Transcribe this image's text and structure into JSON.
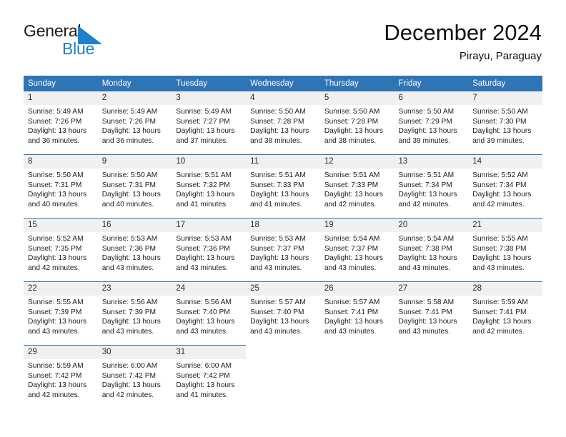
{
  "brand": {
    "name_part1": "General",
    "name_part2": "Blue",
    "logo_icon": "triangle-logo-icon",
    "color_primary": "#1f7fd0",
    "color_dark": "#1a1a1a"
  },
  "header": {
    "title": "December 2024",
    "subtitle": "Pirayu, Paraguay"
  },
  "theme": {
    "header_row_bg": "#2f74b5",
    "day_number_bg": "#f0f0f0",
    "cell_border": "#2f74b5",
    "text": "#1c1c1c"
  },
  "weekdays": [
    "Sunday",
    "Monday",
    "Tuesday",
    "Wednesday",
    "Thursday",
    "Friday",
    "Saturday"
  ],
  "weeks": [
    [
      {
        "day": "1",
        "sunrise": "Sunrise: 5:49 AM",
        "sunset": "Sunset: 7:26 PM",
        "daylight_l1": "Daylight: 13 hours",
        "daylight_l2": "and 36 minutes."
      },
      {
        "day": "2",
        "sunrise": "Sunrise: 5:49 AM",
        "sunset": "Sunset: 7:26 PM",
        "daylight_l1": "Daylight: 13 hours",
        "daylight_l2": "and 36 minutes."
      },
      {
        "day": "3",
        "sunrise": "Sunrise: 5:49 AM",
        "sunset": "Sunset: 7:27 PM",
        "daylight_l1": "Daylight: 13 hours",
        "daylight_l2": "and 37 minutes."
      },
      {
        "day": "4",
        "sunrise": "Sunrise: 5:50 AM",
        "sunset": "Sunset: 7:28 PM",
        "daylight_l1": "Daylight: 13 hours",
        "daylight_l2": "and 38 minutes."
      },
      {
        "day": "5",
        "sunrise": "Sunrise: 5:50 AM",
        "sunset": "Sunset: 7:28 PM",
        "daylight_l1": "Daylight: 13 hours",
        "daylight_l2": "and 38 minutes."
      },
      {
        "day": "6",
        "sunrise": "Sunrise: 5:50 AM",
        "sunset": "Sunset: 7:29 PM",
        "daylight_l1": "Daylight: 13 hours",
        "daylight_l2": "and 39 minutes."
      },
      {
        "day": "7",
        "sunrise": "Sunrise: 5:50 AM",
        "sunset": "Sunset: 7:30 PM",
        "daylight_l1": "Daylight: 13 hours",
        "daylight_l2": "and 39 minutes."
      }
    ],
    [
      {
        "day": "8",
        "sunrise": "Sunrise: 5:50 AM",
        "sunset": "Sunset: 7:31 PM",
        "daylight_l1": "Daylight: 13 hours",
        "daylight_l2": "and 40 minutes."
      },
      {
        "day": "9",
        "sunrise": "Sunrise: 5:50 AM",
        "sunset": "Sunset: 7:31 PM",
        "daylight_l1": "Daylight: 13 hours",
        "daylight_l2": "and 40 minutes."
      },
      {
        "day": "10",
        "sunrise": "Sunrise: 5:51 AM",
        "sunset": "Sunset: 7:32 PM",
        "daylight_l1": "Daylight: 13 hours",
        "daylight_l2": "and 41 minutes."
      },
      {
        "day": "11",
        "sunrise": "Sunrise: 5:51 AM",
        "sunset": "Sunset: 7:33 PM",
        "daylight_l1": "Daylight: 13 hours",
        "daylight_l2": "and 41 minutes."
      },
      {
        "day": "12",
        "sunrise": "Sunrise: 5:51 AM",
        "sunset": "Sunset: 7:33 PM",
        "daylight_l1": "Daylight: 13 hours",
        "daylight_l2": "and 42 minutes."
      },
      {
        "day": "13",
        "sunrise": "Sunrise: 5:51 AM",
        "sunset": "Sunset: 7:34 PM",
        "daylight_l1": "Daylight: 13 hours",
        "daylight_l2": "and 42 minutes."
      },
      {
        "day": "14",
        "sunrise": "Sunrise: 5:52 AM",
        "sunset": "Sunset: 7:34 PM",
        "daylight_l1": "Daylight: 13 hours",
        "daylight_l2": "and 42 minutes."
      }
    ],
    [
      {
        "day": "15",
        "sunrise": "Sunrise: 5:52 AM",
        "sunset": "Sunset: 7:35 PM",
        "daylight_l1": "Daylight: 13 hours",
        "daylight_l2": "and 42 minutes."
      },
      {
        "day": "16",
        "sunrise": "Sunrise: 5:53 AM",
        "sunset": "Sunset: 7:36 PM",
        "daylight_l1": "Daylight: 13 hours",
        "daylight_l2": "and 43 minutes."
      },
      {
        "day": "17",
        "sunrise": "Sunrise: 5:53 AM",
        "sunset": "Sunset: 7:36 PM",
        "daylight_l1": "Daylight: 13 hours",
        "daylight_l2": "and 43 minutes."
      },
      {
        "day": "18",
        "sunrise": "Sunrise: 5:53 AM",
        "sunset": "Sunset: 7:37 PM",
        "daylight_l1": "Daylight: 13 hours",
        "daylight_l2": "and 43 minutes."
      },
      {
        "day": "19",
        "sunrise": "Sunrise: 5:54 AM",
        "sunset": "Sunset: 7:37 PM",
        "daylight_l1": "Daylight: 13 hours",
        "daylight_l2": "and 43 minutes."
      },
      {
        "day": "20",
        "sunrise": "Sunrise: 5:54 AM",
        "sunset": "Sunset: 7:38 PM",
        "daylight_l1": "Daylight: 13 hours",
        "daylight_l2": "and 43 minutes."
      },
      {
        "day": "21",
        "sunrise": "Sunrise: 5:55 AM",
        "sunset": "Sunset: 7:38 PM",
        "daylight_l1": "Daylight: 13 hours",
        "daylight_l2": "and 43 minutes."
      }
    ],
    [
      {
        "day": "22",
        "sunrise": "Sunrise: 5:55 AM",
        "sunset": "Sunset: 7:39 PM",
        "daylight_l1": "Daylight: 13 hours",
        "daylight_l2": "and 43 minutes."
      },
      {
        "day": "23",
        "sunrise": "Sunrise: 5:56 AM",
        "sunset": "Sunset: 7:39 PM",
        "daylight_l1": "Daylight: 13 hours",
        "daylight_l2": "and 43 minutes."
      },
      {
        "day": "24",
        "sunrise": "Sunrise: 5:56 AM",
        "sunset": "Sunset: 7:40 PM",
        "daylight_l1": "Daylight: 13 hours",
        "daylight_l2": "and 43 minutes."
      },
      {
        "day": "25",
        "sunrise": "Sunrise: 5:57 AM",
        "sunset": "Sunset: 7:40 PM",
        "daylight_l1": "Daylight: 13 hours",
        "daylight_l2": "and 43 minutes."
      },
      {
        "day": "26",
        "sunrise": "Sunrise: 5:57 AM",
        "sunset": "Sunset: 7:41 PM",
        "daylight_l1": "Daylight: 13 hours",
        "daylight_l2": "and 43 minutes."
      },
      {
        "day": "27",
        "sunrise": "Sunrise: 5:58 AM",
        "sunset": "Sunset: 7:41 PM",
        "daylight_l1": "Daylight: 13 hours",
        "daylight_l2": "and 43 minutes."
      },
      {
        "day": "28",
        "sunrise": "Sunrise: 5:59 AM",
        "sunset": "Sunset: 7:41 PM",
        "daylight_l1": "Daylight: 13 hours",
        "daylight_l2": "and 42 minutes."
      }
    ],
    [
      {
        "day": "29",
        "sunrise": "Sunrise: 5:59 AM",
        "sunset": "Sunset: 7:42 PM",
        "daylight_l1": "Daylight: 13 hours",
        "daylight_l2": "and 42 minutes."
      },
      {
        "day": "30",
        "sunrise": "Sunrise: 6:00 AM",
        "sunset": "Sunset: 7:42 PM",
        "daylight_l1": "Daylight: 13 hours",
        "daylight_l2": "and 42 minutes."
      },
      {
        "day": "31",
        "sunrise": "Sunrise: 6:00 AM",
        "sunset": "Sunset: 7:42 PM",
        "daylight_l1": "Daylight: 13 hours",
        "daylight_l2": "and 41 minutes."
      },
      {
        "day": "",
        "sunrise": "",
        "sunset": "",
        "daylight_l1": "",
        "daylight_l2": "",
        "blank": true
      },
      {
        "day": "",
        "sunrise": "",
        "sunset": "",
        "daylight_l1": "",
        "daylight_l2": "",
        "blank": true
      },
      {
        "day": "",
        "sunrise": "",
        "sunset": "",
        "daylight_l1": "",
        "daylight_l2": "",
        "blank": true
      },
      {
        "day": "",
        "sunrise": "",
        "sunset": "",
        "daylight_l1": "",
        "daylight_l2": "",
        "blank": true
      }
    ]
  ]
}
